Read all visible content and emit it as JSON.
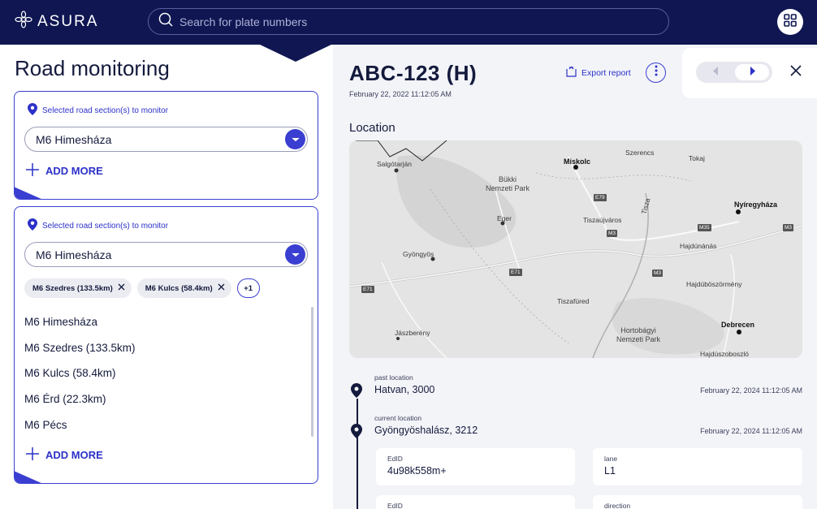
{
  "app": {
    "brand": "ASURA"
  },
  "search": {
    "placeholder": "Search for plate numbers"
  },
  "left": {
    "title": "Road monitoring",
    "card1": {
      "label": "Selected road section(s) to monitor",
      "selected": "M6 Himesháza",
      "add_more": "ADD MORE"
    },
    "card2": {
      "label": "Selected road section(s) to monitor",
      "selected": "M6 Himesháza",
      "chips": [
        "M6 Szedres (133.5km)",
        "M6 Kulcs (58.4km)"
      ],
      "chip_more": "+1",
      "options": [
        "M6 Himesháza",
        "M6 Szedres (133.5km)",
        "M6 Kulcs (58.4km)",
        "M6 Érd (22.3km)",
        "M6 Pécs"
      ],
      "add_more": "ADD MORE"
    }
  },
  "detail": {
    "plate": "ABC-123 (H)",
    "timestamp": "February 22, 2022  11:12:05 AM",
    "export_label": "Export report",
    "location_title": "Location",
    "map": {
      "cities": {
        "salgotarjan": "Salgótarján",
        "miskolc": "Miskolc",
        "szerencs": "Szerencs",
        "tokaj": "Tokaj",
        "bukki": "Bükki\nNemzeti Park",
        "nyiregyhaza": "Nyíregyháza",
        "eger": "Eger",
        "tiszaujvaros": "Tiszaújváros",
        "tisza": "Tisza",
        "hajdunanas": "Hajdúnánás",
        "gyongyos": "Gyöngyös",
        "hajduboszormeny": "Hajdúböszörmény",
        "tiszafured": "Tiszafüred",
        "jaszbereny": "Jászberény",
        "hortobagyi": "Hortobágyi\nNemzeti Park",
        "debrecen": "Debrecen",
        "hajduszoboszlo": "Hajdúszoboszló"
      },
      "shields": {
        "e79": "E79",
        "m3a": "M3",
        "m3b": "M3",
        "e71": "E71",
        "e71b": "E71",
        "m35": "M35",
        "m3c": "M3"
      }
    },
    "timeline": {
      "past_label": "past location",
      "past_place": "Hatvan, 3000",
      "past_date": "February 22, 2024 11:12:05 AM",
      "current_label": "current location",
      "current_place": "Gyöngyöshalász, 3212",
      "current_date": "February 22, 2024 11:12:05 AM",
      "fields": [
        {
          "key": "EdID",
          "value": "4u98k558m+"
        },
        {
          "key": "lane",
          "value": "L1"
        },
        {
          "key": "EdID",
          "value": ""
        },
        {
          "key": "direction",
          "value": ""
        }
      ]
    }
  },
  "colors": {
    "navy": "#0f1652",
    "accent": "#3a3fd1"
  }
}
